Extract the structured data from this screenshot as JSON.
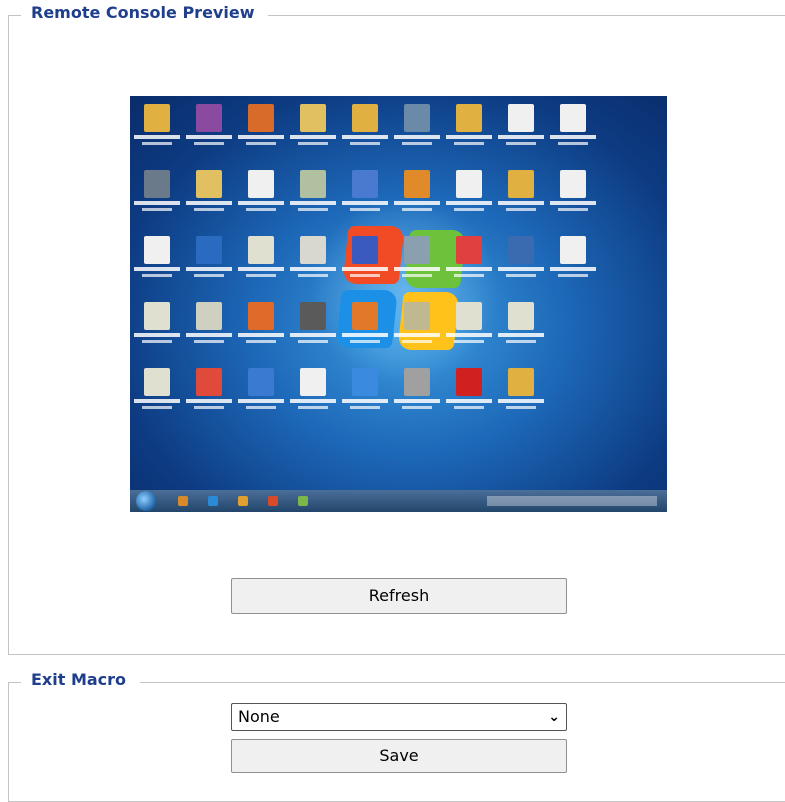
{
  "preview_section": {
    "legend": "Remote Console Preview",
    "refresh_label": "Refresh",
    "screenshot_description_icons": [
      "desktop-icon"
    ]
  },
  "macro_section": {
    "legend": "Exit Macro",
    "selected_value": "None",
    "save_label": "Save"
  },
  "colors": {
    "legend_text": "#1f3f8c",
    "border": "#c4c4c4",
    "button_bg": "#f0f0f0"
  }
}
